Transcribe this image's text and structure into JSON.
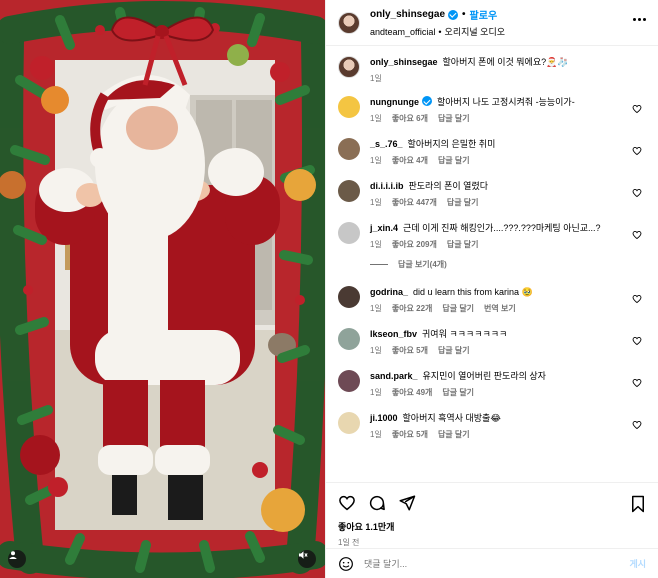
{
  "header": {
    "username": "only_shinsegae",
    "follow_label": "팔로우",
    "audio_user": "andteam_official",
    "audio_label": "오리지널 오디오"
  },
  "caption": {
    "username": "only_shinsegae",
    "text": "할아버지 폰에 이것 뭐에요?🎅🧦",
    "time": "1일"
  },
  "comments": [
    {
      "username": "nungnunge",
      "verified": true,
      "text": "할아버지 나도 고정시켜줘 -능능이가-",
      "time": "1일",
      "likes": "좋아요 6개",
      "reply": "답글 달기",
      "avatar_color": "#f4c542",
      "extra": ""
    },
    {
      "username": "_s_.76_",
      "verified": false,
      "text": "할아버지의 은밀한 취미",
      "time": "1일",
      "likes": "좋아요 4개",
      "reply": "답글 달기",
      "avatar_color": "#8a6e55",
      "extra": ""
    },
    {
      "username": "di.i.i.i.ib",
      "verified": false,
      "text": "판도라의 폰이 열렸다",
      "time": "1일",
      "likes": "좋아요 447개",
      "reply": "답글 달기",
      "avatar_color": "#6b5a48",
      "extra": ""
    },
    {
      "username": "j_xin.4",
      "verified": false,
      "text": "근데 이게 진짜 해킹인가....???.???마케팅 아닌교...?",
      "time": "1일",
      "likes": "좋아요 209개",
      "reply": "답글 달기",
      "avatar_color": "#c7c7c7",
      "extra": ""
    },
    {
      "username": "godrina_",
      "verified": false,
      "text": "did u learn this from karina 🥹",
      "time": "1일",
      "likes": "좋아요 22개",
      "reply": "답글 달기",
      "avatar_color": "#4a3a33",
      "extra": "번역 보기"
    },
    {
      "username": "lkseon_fbv",
      "verified": false,
      "text": "귀여워 ㅋㅋㅋㅋㅋㅋㅋ",
      "time": "1일",
      "likes": "좋아요 5개",
      "reply": "답글 달기",
      "avatar_color": "#8fa39a",
      "extra": ""
    },
    {
      "username": "sand.park_",
      "verified": false,
      "text": "유지민이 열어버린 판도라의 상자",
      "time": "1일",
      "likes": "좋아요 49개",
      "reply": "답글 달기",
      "avatar_color": "#6e4a55",
      "extra": ""
    },
    {
      "username": "ji.1000",
      "verified": false,
      "text": "할아버지 흑역사 대방출😂",
      "time": "1일",
      "likes": "좋아요 5개",
      "reply": "답글 달기",
      "avatar_color": "#e8d7b0",
      "extra": ""
    }
  ],
  "replies_toggle": "답글 보기(4개)",
  "actions": {
    "likes": "좋아요 1.1만개",
    "posted": "1일 전",
    "comment_placeholder": "댓글 달기...",
    "post_label": "게시"
  },
  "colors": {
    "accent": "#0095f6",
    "muted": "#737373",
    "frame_red": "#b8262c",
    "santa_red": "#a5141d"
  }
}
